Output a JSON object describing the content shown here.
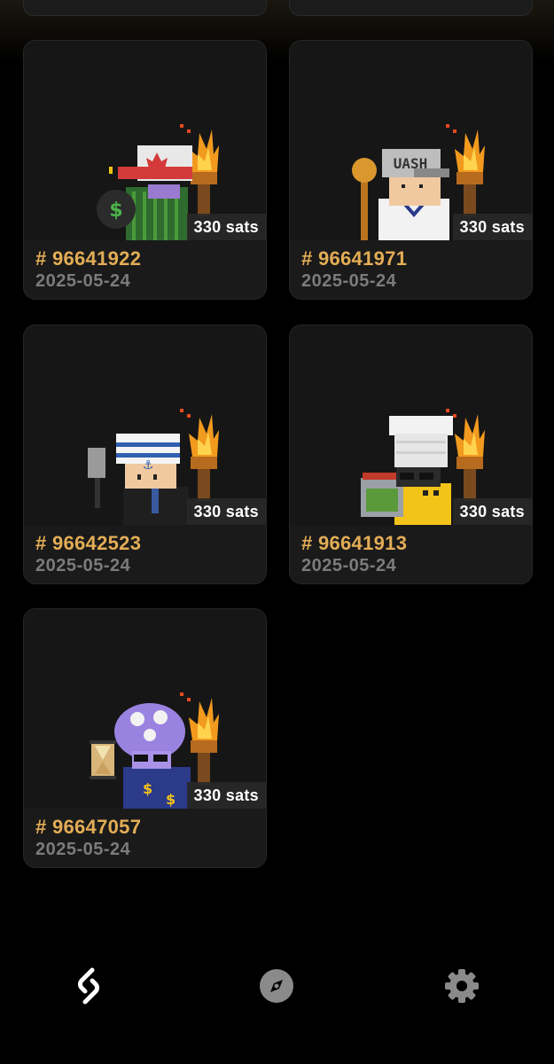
{
  "items": [
    {
      "inscription_label": "# 96641922",
      "date": "2025-05-24",
      "price": "330 sats",
      "avatar": "cactus-redcap",
      "color": "#2f6a2f"
    },
    {
      "inscription_label": "# 96641971",
      "date": "2025-05-24",
      "price": "330 sats",
      "avatar": "sailor-cap",
      "color": "#f0f0f0"
    },
    {
      "inscription_label": "# 96642523",
      "date": "2025-05-24",
      "price": "330 sats",
      "avatar": "captain-spatula",
      "color": "#222222"
    },
    {
      "inscription_label": "# 96641913",
      "date": "2025-05-24",
      "price": "330 sats",
      "avatar": "chef-hat",
      "color": "#f2c318"
    },
    {
      "inscription_label": "# 96647057",
      "date": "2025-05-24",
      "price": "330 sats",
      "avatar": "mushroom-hourglass",
      "color": "#8a6fd6"
    }
  ],
  "tabs": [
    {
      "icon": "link-icon",
      "active": true
    },
    {
      "icon": "compass-icon",
      "active": false
    },
    {
      "icon": "gear-icon",
      "active": false
    }
  ],
  "colors": {
    "accent": "#e3ad55",
    "date": "#7b7b7b",
    "card_bg": "#1a1a1a"
  }
}
